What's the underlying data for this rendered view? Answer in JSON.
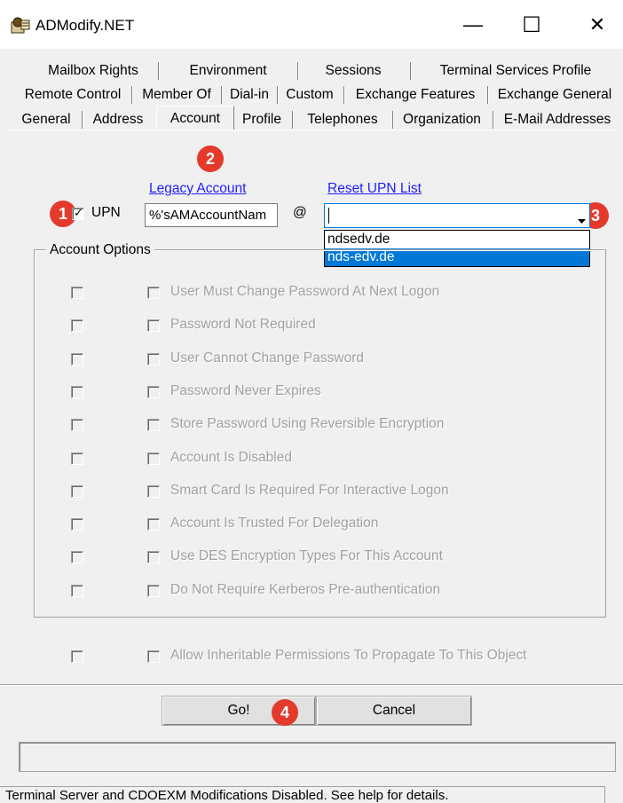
{
  "window": {
    "title": "ADModify.NET",
    "minimize": "—",
    "maximize": "☐",
    "close": "✕"
  },
  "tabs": {
    "row1": [
      "Mailbox Rights",
      "Environment",
      "Sessions",
      "Terminal Services Profile"
    ],
    "row2": [
      "Remote Control",
      "Member Of",
      "Dial-in",
      "Custom",
      "Exchange Features",
      "Exchange General"
    ],
    "row3": [
      "General",
      "Address",
      "Account",
      "Profile",
      "Telephones",
      "Organization",
      "E-Mail Addresses"
    ],
    "active": "Account"
  },
  "upn": {
    "checkbox_label": "UPN",
    "checked": true,
    "legacy_link": "Legacy Account",
    "value": "%'sAMAccountNam",
    "at_sign": "@",
    "reset_link": "Reset UPN List",
    "suffix_value": "",
    "suffix_options": [
      "ndsedv.de",
      "nds-edv.de"
    ],
    "highlighted_option": "nds-edv.de"
  },
  "badges": [
    "1",
    "2",
    "3",
    "4"
  ],
  "account_options": {
    "legend": "Account Options",
    "items": [
      "User Must Change Password At Next Logon",
      "Password Not Required",
      "User Cannot Change Password",
      "Password Never Expires",
      "Store Password Using Reversible Encryption",
      "Account Is Disabled",
      "Smart Card Is Required For Interactive Logon",
      "Account Is Trusted For Delegation",
      "Use DES Encryption Types For This Account",
      "Do Not Require Kerberos Pre-authentication"
    ]
  },
  "inherit": {
    "label": "Allow Inheritable Permissions To Propagate To This Object"
  },
  "buttons": {
    "go": "Go!",
    "cancel": "Cancel"
  },
  "status": {
    "text": "Terminal Server and CDOEXM Modifications Disabled.  See help for details."
  },
  "colors": {
    "badge": "#e33a2c",
    "link": "#1f1fff",
    "selection": "#0078d7"
  }
}
